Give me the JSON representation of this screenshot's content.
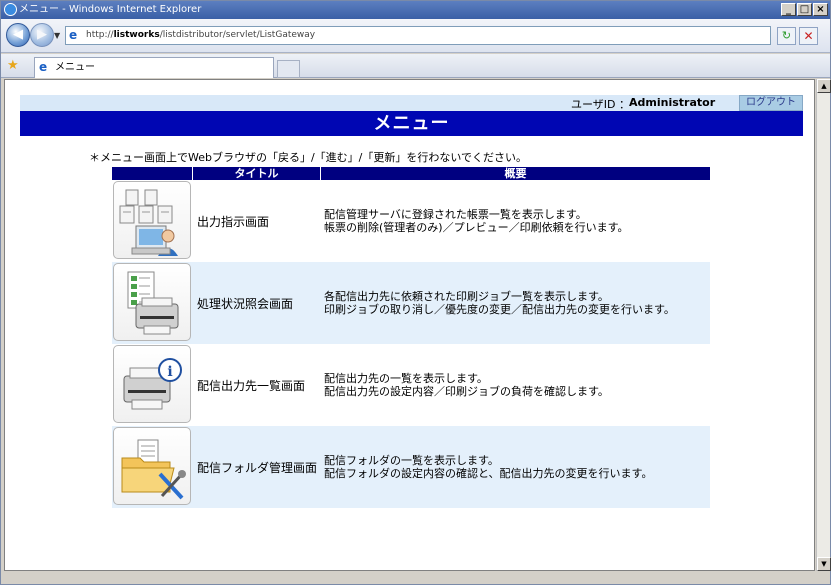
{
  "window": {
    "title": "メニュー - Windows Internet Explorer",
    "controls": [
      "_",
      "□",
      "×"
    ]
  },
  "navbar": {
    "address_prefix": "http://",
    "address_host": "listworks",
    "address_path": "/listdistributor/servlet/ListGateway",
    "back_icon": "back-arrow-icon",
    "forward_icon": "forward-arrow-icon"
  },
  "tabs": [
    {
      "label": "メニュー",
      "active": true
    }
  ],
  "page": {
    "user_label": "ユーザID ：",
    "user_id": "Administrator",
    "logout_label": "ログアウト",
    "banner_title": "メニュー",
    "notice": "＊メニュー画面上でWebブラウザの「戻る」/「進む」/「更新」を行わないでください。",
    "table": {
      "headers": [
        "タイトル",
        "概要"
      ],
      "rows": [
        {
          "icon": "output-instruction-icon",
          "title": "出力指示画面",
          "desc": [
            "配信管理サーバに登録された帳票一覧を表示します。",
            "帳票の削除(管理者のみ)／プレビュー／印刷依頼を行います。"
          ]
        },
        {
          "icon": "job-status-icon",
          "title": "処理状況照会画面",
          "desc": [
            "各配信出力先に依頼された印刷ジョブ一覧を表示します。",
            "印刷ジョブの取り消し／優先度の変更／配信出力先の変更を行います。"
          ]
        },
        {
          "icon": "printer-info-icon",
          "title": "配信出力先一覧画面",
          "desc": [
            "配信出力先の一覧を表示します。",
            "配信出力先の設定内容／印刷ジョブの負荷を確認します。"
          ]
        },
        {
          "icon": "folder-tools-icon",
          "title": "配信フォルダ管理画面",
          "desc": [
            "配信フォルダの一覧を表示します。",
            "配信フォルダの設定内容の確認と、配信出力先の変更を行います。"
          ]
        }
      ]
    }
  },
  "colors": {
    "banner": "#0006b3",
    "header": "#000080",
    "userbar": "#d8e8f8",
    "row_alt": "#e4f0fb"
  }
}
